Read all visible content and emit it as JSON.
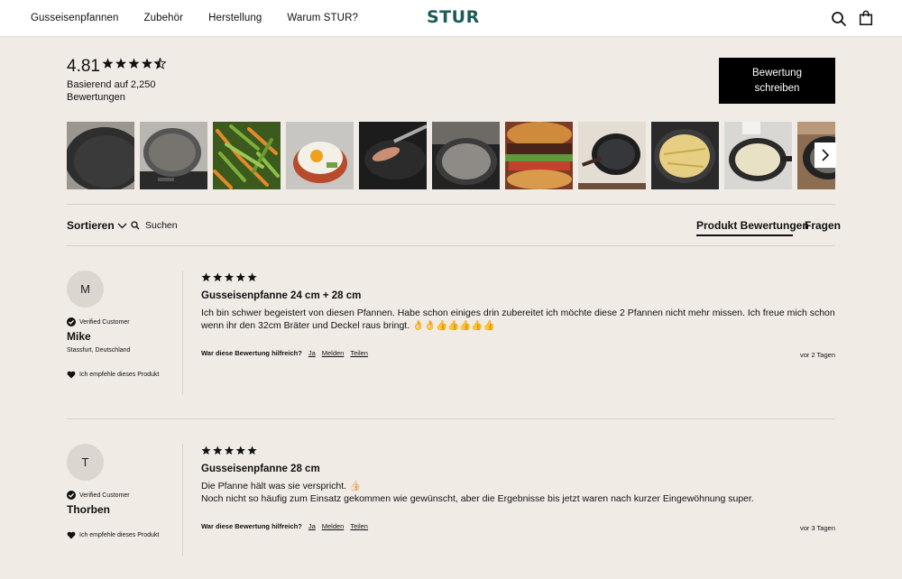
{
  "header": {
    "nav": [
      "Gusseisenpfannen",
      "Zubehör",
      "Herstellung",
      "Warum STUR?"
    ],
    "logo": "STUR",
    "icons": [
      "search-icon",
      "shopping-bag-icon"
    ]
  },
  "summary": {
    "rating": "4.81",
    "stars_value": 4.81,
    "basis": "Basierend auf 2,250 Bewertungen",
    "write_button": "Bewertung schreiben"
  },
  "gallery": {
    "photos": [
      "cast-iron-pan-top-view",
      "pan-on-stove",
      "green-beans-and-carrots",
      "fried-egg",
      "pan-with-spatula",
      "pan-on-stovetop",
      "burger",
      "pan-on-table",
      "crepes-in-pan",
      "pan-with-batter",
      "pan-partial"
    ],
    "next_icon": "chevron-right-icon"
  },
  "toolbar": {
    "sort_label": "Sortieren",
    "search_label": "Suchen",
    "tabs": [
      "Produkt Bewertungen",
      "Fragen"
    ],
    "active_tab": "Produkt Bewertungen"
  },
  "reviews": [
    {
      "initial": "M",
      "verified": "Verified Customer",
      "name": "Mike",
      "location": "Stassfurt, Deutschland",
      "recommend": "Ich empfehle dieses Produkt",
      "stars": 5,
      "title": "Gusseisenpfanne 24 cm + 28 cm",
      "body": [
        "Ich bin schwer begeistert von diesen Pfannen. Habe schon einiges drin zubereitet ich möchte diese 2 Pfannen nicht mehr missen. Ich freue mich schon wenn ihr den 32cm Bräter und Deckel  raus bringt. 👌👌👍👍👍👍👍"
      ],
      "helpful": "War diese Bewertung hilfreich?",
      "actions": [
        "Ja",
        "Melden",
        "Teilen"
      ],
      "date": "vor 2 Tagen"
    },
    {
      "initial": "T",
      "verified": "Verified Customer",
      "name": "Thorben",
      "location": "",
      "recommend": "Ich empfehle dieses Produkt",
      "stars": 5,
      "title": "Gusseisenpfanne 28 cm",
      "body": [
        "Die Pfanne hält was sie verspricht. 👍🏻",
        "Noch nicht so häufig zum Einsatz gekommen wie gewünscht, aber die Ergebnisse bis jetzt waren nach kurzer Eingewöhnung super."
      ],
      "helpful": "War diese Bewertung hilfreich?",
      "actions": [
        "Ja",
        "Melden",
        "Teilen"
      ],
      "date": "vor 3 Tagen"
    }
  ]
}
